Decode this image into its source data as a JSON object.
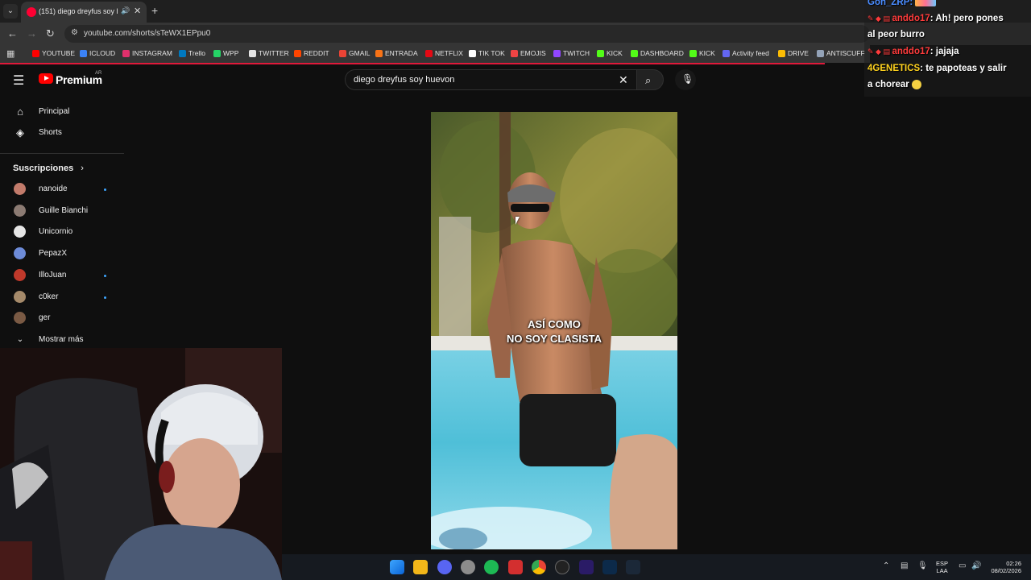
{
  "browser": {
    "tab_title": "(151) diego dreyfus soy hu...",
    "url": "youtube.com/shorts/sTeWX1EPpu0",
    "bookmarks": [
      {
        "label": "YOUTUBE",
        "color": "#ff0000"
      },
      {
        "label": "ICLOUD",
        "color": "#3b82f6"
      },
      {
        "label": "INSTAGRAM",
        "color": "#e1306c"
      },
      {
        "label": "Trello",
        "color": "#0079bf"
      },
      {
        "label": "WPP",
        "color": "#25d366"
      },
      {
        "label": "TWITTER",
        "color": "#e5e5e5"
      },
      {
        "label": "REDDIT",
        "color": "#ff4500"
      },
      {
        "label": "GMAIL",
        "color": "#ea4335"
      },
      {
        "label": "ENTRADA",
        "color": "#f97316"
      },
      {
        "label": "NETFLIX",
        "color": "#e50914"
      },
      {
        "label": "TIK TOK",
        "color": "#ffffff"
      },
      {
        "label": "EMOJIS",
        "color": "#ef4444"
      },
      {
        "label": "TWITCH",
        "color": "#9146ff"
      },
      {
        "label": "KICK",
        "color": "#53fc18"
      },
      {
        "label": "DASHBOARD",
        "color": "#53fc18"
      },
      {
        "label": "KICK",
        "color": "#53fc18"
      },
      {
        "label": "Activity feed",
        "color": "#6366f1"
      },
      {
        "label": "DRIVE",
        "color": "#fbbc04"
      },
      {
        "label": "ANTISCUFF",
        "color": "#94a3b8"
      }
    ]
  },
  "youtube": {
    "brand": "Premium",
    "region": "AR",
    "search_query": "diego dreyfus soy huevon",
    "nav": [
      {
        "label": "Principal",
        "icon": "home-icon"
      },
      {
        "label": "Shorts",
        "icon": "shorts-icon"
      }
    ],
    "subscriptions_title": "Suscripciones",
    "subscriptions": [
      {
        "name": "nanoide",
        "new": true,
        "color": "#c27b6b"
      },
      {
        "name": "Guille Bianchi",
        "new": false,
        "color": "#8c7b73"
      },
      {
        "name": "Unicornio",
        "new": false,
        "color": "#e6e6e6"
      },
      {
        "name": "PepazX",
        "new": false,
        "color": "#6d8bd8"
      },
      {
        "name": "IlloJuan",
        "new": true,
        "color": "#c0392b"
      },
      {
        "name": "c0ker",
        "new": true,
        "color": "#a58a6a"
      },
      {
        "name": "ger",
        "new": false,
        "color": "#7a5a44"
      }
    ],
    "show_more": "Mostrar más",
    "video_caption_line1": "ASÍ COMO",
    "video_caption_line2": "NO SOY CLASISTA"
  },
  "chat": [
    {
      "user": "Gon_ZRP",
      "user_color": "#4a8cff",
      "message": ""
    },
    {
      "user": "anddo17",
      "user_color": "#ff3b3b",
      "message": "Ah! pero pones"
    },
    {
      "user": "",
      "user_color": "#ffffff",
      "message": "al peor burro"
    },
    {
      "user": "anddo17",
      "user_color": "#ff3b3b",
      "message": "jajaja"
    },
    {
      "user": "4GENETICS",
      "user_color": "#ffd21e",
      "message": "te papoteas y salir"
    },
    {
      "user": "",
      "user_color": "#ffffff",
      "message": "a chorear"
    }
  ],
  "taskbar": {
    "lang_top": "ESP",
    "lang_bottom": "LAA",
    "time": "02:26",
    "date": "08/02/2026"
  }
}
